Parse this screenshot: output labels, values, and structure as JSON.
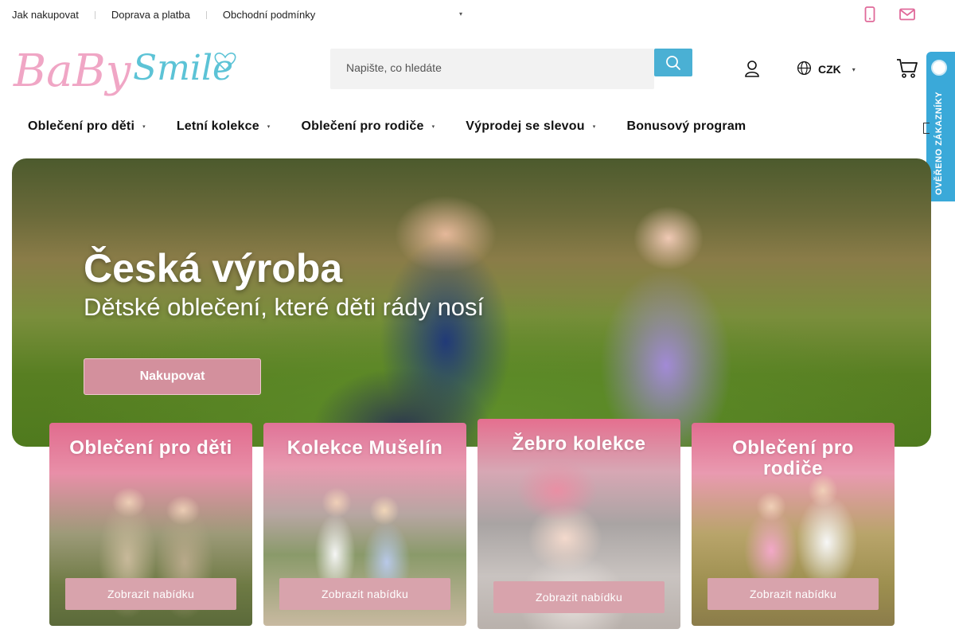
{
  "topbar": {
    "links": [
      "Jak nakupovat",
      "Doprava a platba",
      "Obchodní podmínky"
    ]
  },
  "brand": {
    "logo_text_1": "BaBy",
    "logo_text_2": "Smile",
    "colors": {
      "pink": "#e8a1c0",
      "blue": "#4ab0d4",
      "accent": "#d3909d"
    }
  },
  "header": {
    "search_placeholder": "Napište, co hledáte",
    "currency": "CZK",
    "badge_text": "OVĚŘENO ZÁKAZNÍKY"
  },
  "nav": {
    "items": [
      {
        "label": "Oblečení pro děti",
        "has_dropdown": true
      },
      {
        "label": "Letní kolekce",
        "has_dropdown": true
      },
      {
        "label": "Oblečení pro rodiče",
        "has_dropdown": true
      },
      {
        "label": "Výprodej se slevou",
        "has_dropdown": true
      },
      {
        "label": "Bonusový program",
        "has_dropdown": false
      }
    ]
  },
  "hero": {
    "title": "Česká výroba",
    "subtitle": "Dětské oblečení, které děti rády nosí",
    "cta": "Nakupovat"
  },
  "categories": [
    {
      "title": "Oblečení pro děti",
      "button": "Zobrazit nabídku"
    },
    {
      "title": "Kolekce Mušelín",
      "button": "Zobrazit nabídku"
    },
    {
      "title": "Žebro kolekce",
      "button": "Zobrazit nabídku"
    },
    {
      "title": "Oblečení pro rodiče",
      "button": "Zobrazit nabídku"
    }
  ],
  "icons": [
    "phone-icon",
    "mail-icon",
    "search-icon",
    "user-icon",
    "globe-icon",
    "cart-icon",
    "chevron-down-icon"
  ]
}
